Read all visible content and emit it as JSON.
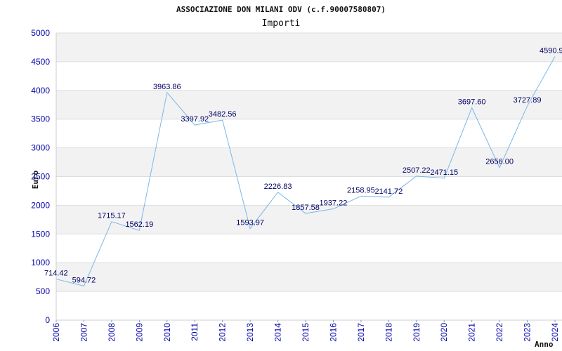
{
  "chart_data": {
    "type": "line",
    "title": "ASSOCIAZIONE DON MILANI ODV (c.f.90007580807)",
    "subtitle": "Importi",
    "xlabel": "Anno",
    "ylabel": "Euro",
    "ylim": [
      0,
      5000
    ],
    "yticks": [
      "0",
      "500",
      "1000",
      "1500",
      "2000",
      "2500",
      "3000",
      "3500",
      "4000",
      "4500",
      "5000"
    ],
    "grid": "horizontal bands",
    "line_color": "#7ab8e8",
    "band_color": "#f2f2f2",
    "tick_color": "#0000aa",
    "categories": [
      "2006",
      "2007",
      "2008",
      "2009",
      "2010",
      "2011",
      "2012",
      "2013",
      "2014",
      "2015",
      "2016",
      "2017",
      "2018",
      "2019",
      "2020",
      "2021",
      "2022",
      "2023",
      "2024"
    ],
    "values": [
      714.42,
      594.72,
      1715.17,
      1562.19,
      3963.86,
      3397.92,
      3482.56,
      1593.97,
      2226.83,
      1857.58,
      1937.22,
      2158.95,
      2141.72,
      2507.22,
      2471.15,
      3697.6,
      2656.0,
      3727.89,
      4590.9
    ],
    "labels": [
      "714.42",
      "594.72",
      "1715.17",
      "1562.19",
      "3963.86",
      "3397.92",
      "3482.56",
      "1593.97",
      "2226.83",
      "1857.58",
      "1937.22",
      "2158.95",
      "2141.72",
      "2507.22",
      "2471.15",
      "3697.60",
      "2656.00",
      "3727.89",
      "4590.9"
    ]
  }
}
